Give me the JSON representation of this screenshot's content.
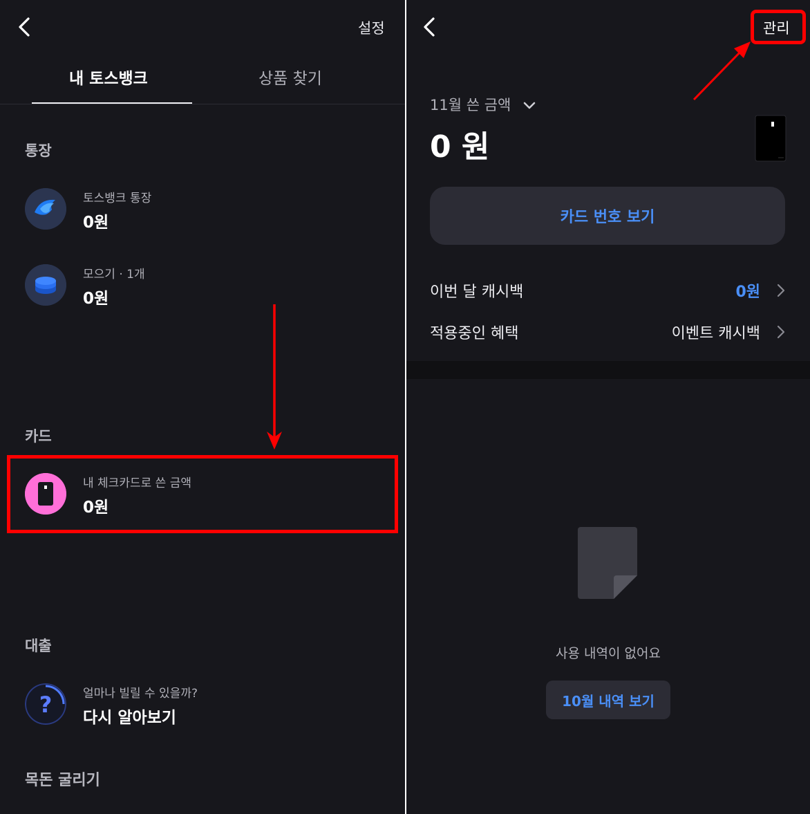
{
  "left": {
    "header": {
      "settings_label": "설정"
    },
    "tabs": [
      {
        "label": "내 토스뱅크"
      },
      {
        "label": "상품 찾기"
      }
    ],
    "sections": {
      "account": {
        "title": "통장",
        "items": [
          {
            "sub": "토스뱅크 통장",
            "value": "0원",
            "icon": "tossbank-logo-icon"
          },
          {
            "sub": "모으기 · 1개",
            "value": "0원",
            "icon": "coins-stack-icon"
          }
        ]
      },
      "card": {
        "title": "카드",
        "item": {
          "sub": "내 체크카드로 쓴 금액",
          "value": "0원",
          "icon": "card-icon"
        }
      },
      "loan": {
        "title": "대출",
        "item": {
          "sub": "얼마나 빌릴 수 있을까?",
          "value": "다시 알아보기",
          "icon": "question-icon"
        }
      },
      "savings": {
        "title": "목돈 굴리기"
      }
    }
  },
  "right": {
    "header": {
      "manage_label": "관리"
    },
    "month_label": "11월 쓴 금액",
    "amount": "0 원",
    "card_number_button": "카드 번호 보기",
    "rows": [
      {
        "label": "이번 달 캐시백",
        "value": "0원"
      },
      {
        "label": "적용중인 혜택",
        "value": "이벤트 캐시백"
      }
    ],
    "empty_state": {
      "message": "사용 내역이 없어요",
      "button": "10월 내역 보기"
    }
  },
  "colors": {
    "background": "#17171c",
    "accent_blue": "#4a8ff7",
    "annotation_red": "#ff0000",
    "card_pink": "#ff6fd8"
  }
}
